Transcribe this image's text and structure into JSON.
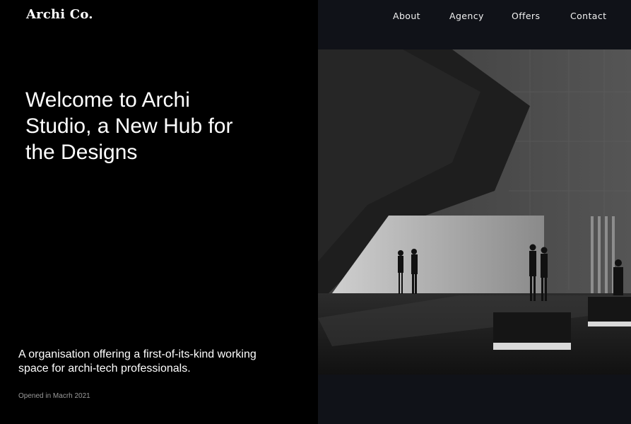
{
  "brand": {
    "logo": "Archi Co."
  },
  "nav": {
    "items": [
      {
        "label": "About"
      },
      {
        "label": "Agency"
      },
      {
        "label": "Offers"
      },
      {
        "label": "Contact"
      }
    ]
  },
  "hero": {
    "headline": "Welcome to Archi Studio, a New Hub for the Designs",
    "tagline": "A organisation offering a first-of-its-kind working space for archi-tech professionals.",
    "opened": "Opened in Macrh 2021"
  },
  "colors": {
    "left_background": "#000000",
    "right_background": "#101218",
    "text": "#ffffff",
    "muted_text": "#9a9a9a"
  },
  "icons": {
    "photo": "architecture-interior-photo"
  }
}
